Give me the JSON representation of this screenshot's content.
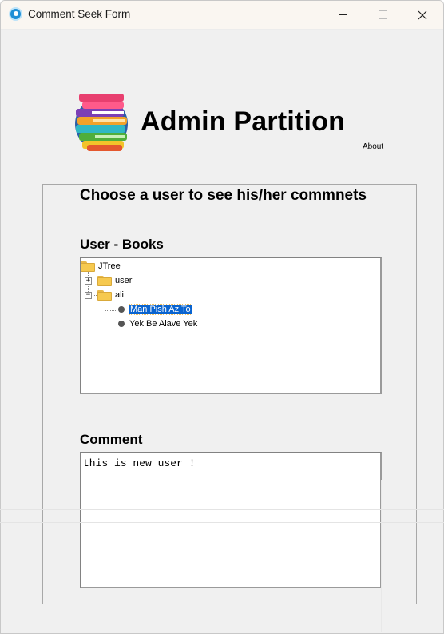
{
  "window": {
    "title": "Comment Seek Form"
  },
  "header": {
    "title": "Admin Partition",
    "about_label": "About"
  },
  "main": {
    "heading": "Choose a user to see his/her commnets",
    "tree_label": "User - Books",
    "comment_label": "Comment"
  },
  "tree": {
    "root": "JTree",
    "nodes": [
      {
        "label": "user",
        "expanded": false
      },
      {
        "label": "ali",
        "expanded": true,
        "children": [
          "Man Pish Az To",
          "Yek Be Alave Yek"
        ]
      }
    ],
    "selected": "Man Pish Az To"
  },
  "comment": {
    "text": "this is new user !"
  },
  "colors": {
    "selection": "#0a64d0",
    "folder": "#f6c94f",
    "window_bg": "#f0f0f0"
  }
}
